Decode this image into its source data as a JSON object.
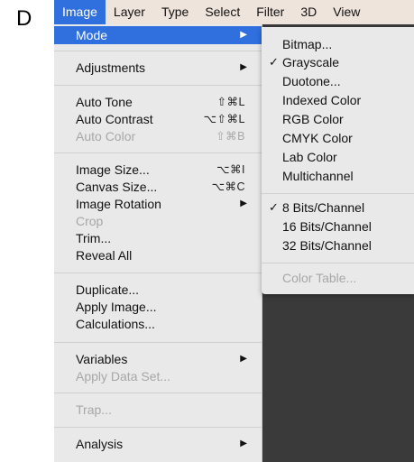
{
  "panel_label": "D",
  "menubar": {
    "items": [
      "Image",
      "Layer",
      "Type",
      "Select",
      "Filter",
      "3D",
      "View"
    ]
  },
  "image_menu": {
    "mode": "Mode",
    "adjustments": "Adjustments",
    "auto_tone": "Auto Tone",
    "auto_tone_sc": "⇧⌘L",
    "auto_contrast": "Auto Contrast",
    "auto_contrast_sc": "⌥⇧⌘L",
    "auto_color": "Auto Color",
    "auto_color_sc": "⇧⌘B",
    "image_size": "Image Size...",
    "image_size_sc": "⌥⌘I",
    "canvas_size": "Canvas Size...",
    "canvas_size_sc": "⌥⌘C",
    "image_rotation": "Image Rotation",
    "crop": "Crop",
    "trim": "Trim...",
    "reveal_all": "Reveal All",
    "duplicate": "Duplicate...",
    "apply_image": "Apply Image...",
    "calculations": "Calculations...",
    "variables": "Variables",
    "apply_data_set": "Apply Data Set...",
    "trap": "Trap...",
    "analysis": "Analysis"
  },
  "mode_submenu": {
    "bitmap": "Bitmap...",
    "grayscale": "Grayscale",
    "duotone": "Duotone...",
    "indexed_color": "Indexed Color",
    "rgb_color": "RGB Color",
    "cmyk_color": "CMYK Color",
    "lab_color": "Lab Color",
    "multichannel": "Multichannel",
    "bits8": "8 Bits/Channel",
    "bits16": "16 Bits/Channel",
    "bits32": "32 Bits/Channel",
    "color_table": "Color Table...",
    "check_mark": "✓"
  },
  "arrow_glyph": "▶"
}
